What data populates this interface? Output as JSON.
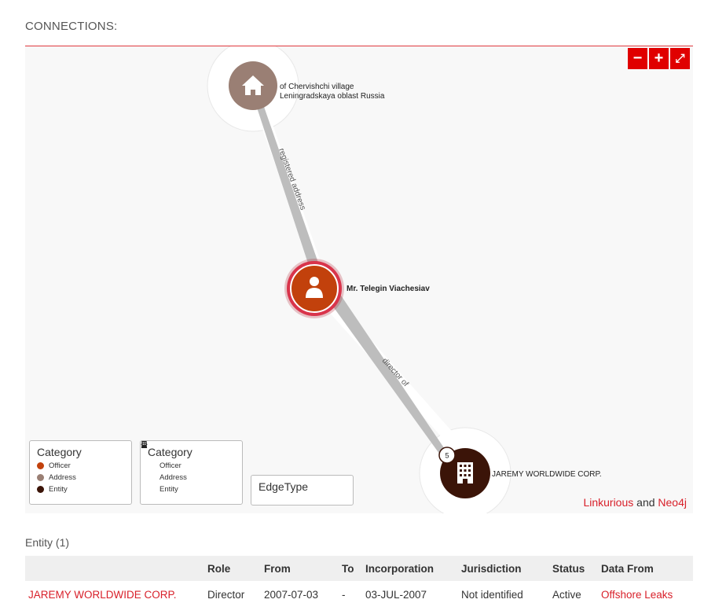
{
  "section": {
    "title": "CONNECTIONS:"
  },
  "graph": {
    "controls": {
      "zoom_out": "−",
      "zoom_in": "+",
      "fullscreen": "⤢"
    },
    "nodes": {
      "address": {
        "label_line1": "of Chervishchi village",
        "label_line2": "Leningradskaya oblast Russia",
        "icon": "house-icon",
        "color": "#9a7f74"
      },
      "officer": {
        "label": "Mr. Telegin Viachesiav",
        "icon": "person-icon",
        "color": "#c2410c"
      },
      "entity": {
        "label": "JAREMY WORLDWIDE CORP.",
        "icon": "building-icon",
        "badge": "5",
        "color": "#3b1408"
      }
    },
    "edges": {
      "registered": "registered address",
      "director": "director of"
    },
    "legend_color": {
      "title": "Category",
      "items": [
        {
          "label": "Officer",
          "color": "#c2410c"
        },
        {
          "label": "Address",
          "color": "#9a7f74"
        },
        {
          "label": "Entity",
          "color": "#3b1408"
        }
      ]
    },
    "legend_icon": {
      "title": "Category",
      "items": [
        {
          "label": "Officer",
          "icon": "person-icon"
        },
        {
          "label": "Address",
          "icon": "house-icon"
        },
        {
          "label": "Entity",
          "icon": "building-icon"
        }
      ]
    },
    "legend_edge": {
      "title": "EdgeType"
    },
    "credit": {
      "link1": "Linkurious",
      "and": "and",
      "link2": "Neo4j"
    }
  },
  "entities": {
    "heading": "Entity (1)",
    "columns": [
      "",
      "Role",
      "From",
      "To",
      "Incorporation",
      "Jurisdiction",
      "Status",
      "Data From"
    ],
    "rows": [
      {
        "name": "JAREMY WORLDWIDE CORP.",
        "role": "Director",
        "from": "2007-07-03",
        "to": "-",
        "incorporation": "03-JUL-2007",
        "jurisdiction": "Not identified",
        "status": "Active",
        "data_from": "Offshore Leaks"
      }
    ]
  },
  "colors": {
    "accent": "#d8202a",
    "zoom_button": "#e00000"
  }
}
